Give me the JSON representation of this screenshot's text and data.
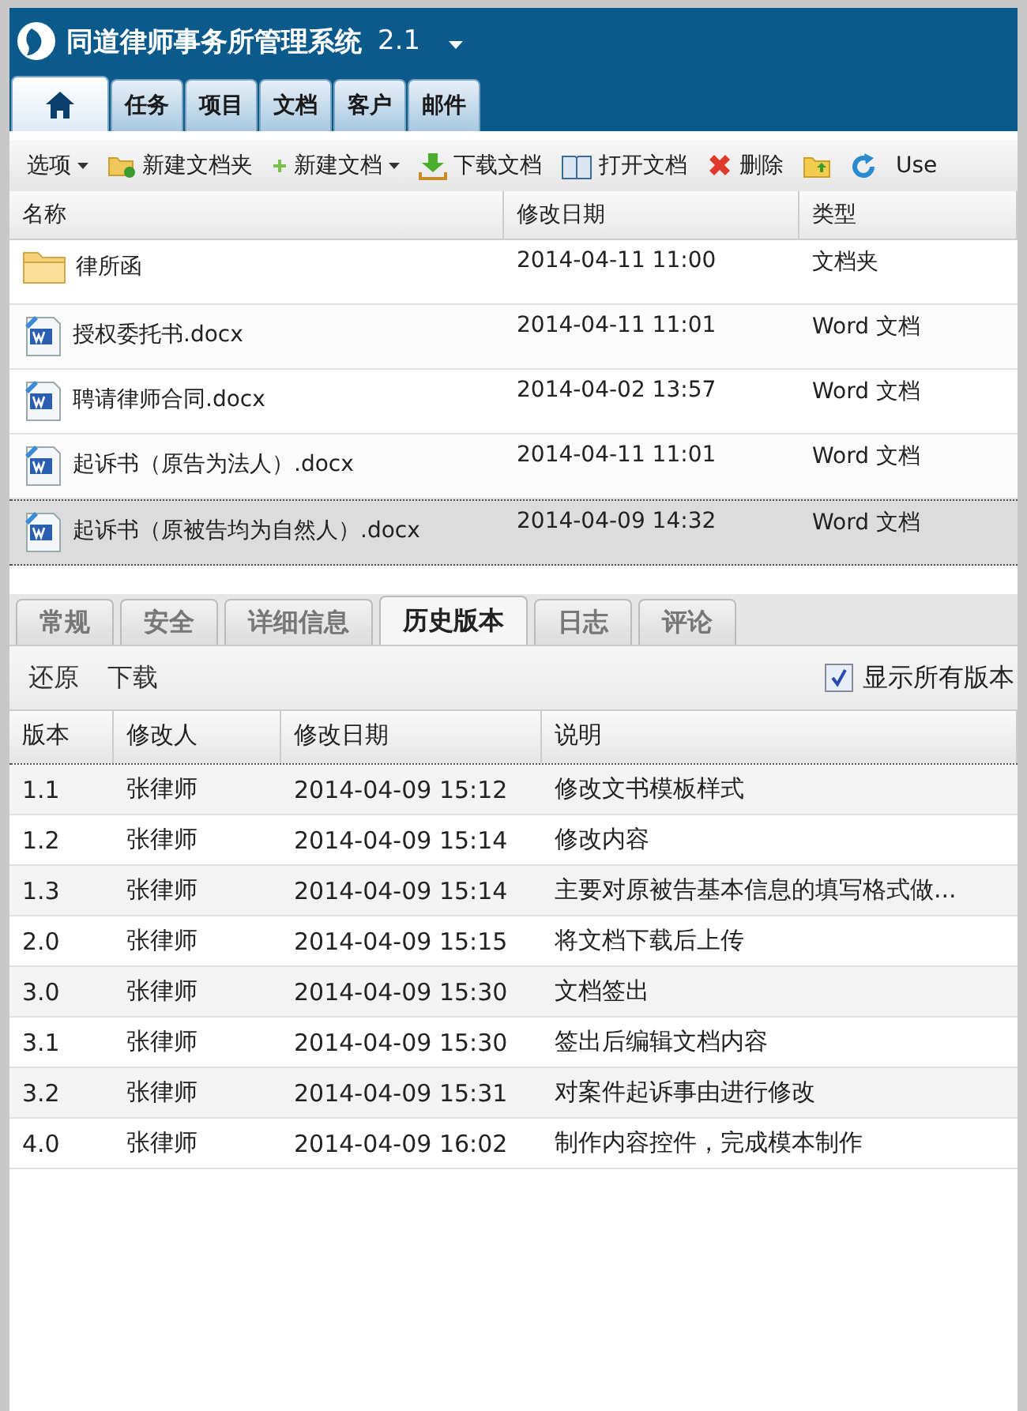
{
  "app": {
    "title": "同道律师事务所管理系统",
    "version": "2.1"
  },
  "nav_tabs": [
    {
      "kind": "home",
      "selected": true
    },
    {
      "kind": "text",
      "label": "任务",
      "selected": false
    },
    {
      "kind": "text",
      "label": "项目",
      "selected": false
    },
    {
      "kind": "text",
      "label": "文档",
      "selected": false
    },
    {
      "kind": "text",
      "label": "客户",
      "selected": false
    },
    {
      "kind": "text",
      "label": "邮件",
      "selected": false
    }
  ],
  "toolbar": [
    {
      "kind": "menu",
      "label": "选项"
    },
    {
      "kind": "newfolder",
      "label": "新建文档夹"
    },
    {
      "kind": "newdoc",
      "label": "新建文档"
    },
    {
      "kind": "download",
      "label": "下载文档"
    },
    {
      "kind": "open",
      "label": "打开文档"
    },
    {
      "kind": "delete",
      "label": "删除"
    },
    {
      "kind": "upload"
    },
    {
      "kind": "refresh"
    },
    {
      "kind": "text",
      "label": "Use"
    }
  ],
  "files": {
    "columns": [
      "名称",
      "修改日期",
      "类型"
    ],
    "rows": [
      {
        "kind": "folder",
        "name": "律所函",
        "modified": "2014-04-11 11:00",
        "type": "文档夹",
        "selected": false
      },
      {
        "kind": "word",
        "name": "授权委托书.docx",
        "modified": "2014-04-11 11:01",
        "type": "Word 文档",
        "selected": false
      },
      {
        "kind": "word",
        "name": "聘请律师合同.docx",
        "modified": "2014-04-02 13:57",
        "type": "Word 文档",
        "selected": false
      },
      {
        "kind": "word",
        "name": "起诉书（原告为法人）.docx",
        "modified": "2014-04-11 11:01",
        "type": "Word 文档",
        "selected": false
      },
      {
        "kind": "word",
        "name": "起诉书（原被告均为自然人）.docx",
        "modified": "2014-04-09 14:32",
        "type": "Word 文档",
        "selected": true
      }
    ]
  },
  "detail_tabs": [
    {
      "label": "常规",
      "selected": false
    },
    {
      "label": "安全",
      "selected": false
    },
    {
      "label": "详细信息",
      "selected": false
    },
    {
      "label": "历史版本",
      "selected": true
    },
    {
      "label": "日志",
      "selected": false
    },
    {
      "label": "评论",
      "selected": false
    }
  ],
  "history_actions": [
    "还原",
    "下载"
  ],
  "show_all_versions": {
    "label": "显示所有版本",
    "checked": true
  },
  "history": {
    "columns": [
      "版本",
      "修改人",
      "修改日期",
      "说明"
    ],
    "rows": [
      [
        "1.1",
        "张律师",
        "2014-04-09 15:12",
        "修改文书模板样式"
      ],
      [
        "1.2",
        "张律师",
        "2014-04-09 15:14",
        "修改内容"
      ],
      [
        "1.3",
        "张律师",
        "2014-04-09 15:14",
        "主要对原被告基本信息的填写格式做..."
      ],
      [
        "2.0",
        "张律师",
        "2014-04-09 15:15",
        "将文档下载后上传"
      ],
      [
        "3.0",
        "张律师",
        "2014-04-09 15:30",
        "文档签出"
      ],
      [
        "3.1",
        "张律师",
        "2014-04-09 15:30",
        "签出后编辑文档内容"
      ],
      [
        "3.2",
        "张律师",
        "2014-04-09 15:31",
        "对案件起诉事由进行修改"
      ],
      [
        "4.0",
        "张律师",
        "2014-04-09 16:02",
        "制作内容控件，完成模本制作"
      ]
    ]
  }
}
